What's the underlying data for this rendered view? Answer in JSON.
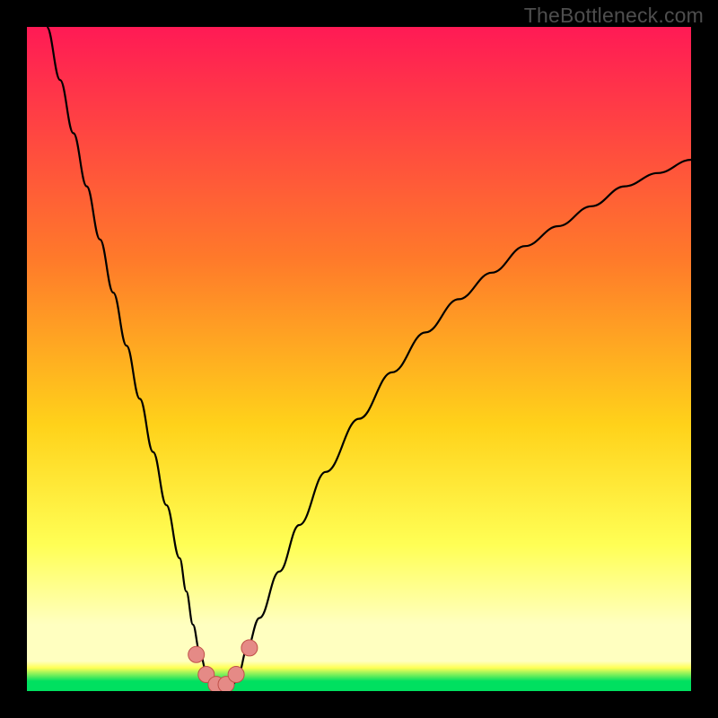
{
  "watermark": "TheBottleneck.com",
  "colors": {
    "top": "#ff1a55",
    "mid1": "#ff7a2a",
    "mid2": "#ffd21a",
    "mid3": "#ffff55",
    "pale": "#ffffc0",
    "green": "#00e060",
    "curve": "#000000",
    "marker_fill": "#e58a86",
    "marker_stroke": "#c05048"
  },
  "chart_data": {
    "type": "line",
    "title": "",
    "xlabel": "",
    "ylabel": "",
    "xlim": [
      0,
      100
    ],
    "ylim": [
      0,
      100
    ],
    "x": [
      3,
      5,
      7,
      9,
      11,
      13,
      15,
      17,
      19,
      21,
      23,
      24,
      25,
      26,
      27,
      28,
      29,
      30,
      31,
      32,
      33,
      35,
      38,
      41,
      45,
      50,
      55,
      60,
      65,
      70,
      75,
      80,
      85,
      90,
      95,
      100
    ],
    "values": [
      100,
      92,
      84,
      76,
      68,
      60,
      52,
      44,
      36,
      28,
      20,
      15,
      10,
      6,
      3,
      1,
      0,
      0,
      1,
      3,
      6,
      11,
      18,
      25,
      33,
      41,
      48,
      54,
      59,
      63,
      67,
      70,
      73,
      76,
      78,
      80
    ],
    "notch_x": 29,
    "markers": [
      {
        "x": 25.5,
        "y": 5.5
      },
      {
        "x": 27.0,
        "y": 2.5
      },
      {
        "x": 28.5,
        "y": 1.0
      },
      {
        "x": 30.0,
        "y": 1.0
      },
      {
        "x": 31.5,
        "y": 2.5
      },
      {
        "x": 33.5,
        "y": 6.5
      }
    ]
  }
}
